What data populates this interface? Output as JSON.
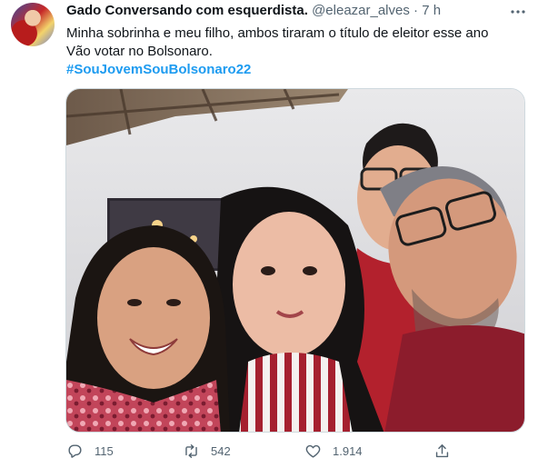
{
  "tweet": {
    "author_name": "Gado Conversando com esquerdista.",
    "handle": "@eleazar_alves",
    "separator": "·",
    "time": "7 h",
    "text_lines": [
      "Minha sobrinha e meu filho, ambos tiraram o título de eleitor esse ano",
      "Vão votar no Bolsonaro."
    ],
    "hashtag": "#SouJovemSouBolsonaro22",
    "actions": {
      "reply": {
        "icon": "reply-icon",
        "count": "115"
      },
      "retweet": {
        "icon": "retweet-icon",
        "count": "542"
      },
      "like": {
        "icon": "heart-icon",
        "count": "1.914"
      },
      "share": {
        "icon": "share-icon"
      }
    }
  },
  "colors": {
    "link": "#1d9bf0",
    "secondary_text": "#536471",
    "primary_text": "#0f1419"
  }
}
